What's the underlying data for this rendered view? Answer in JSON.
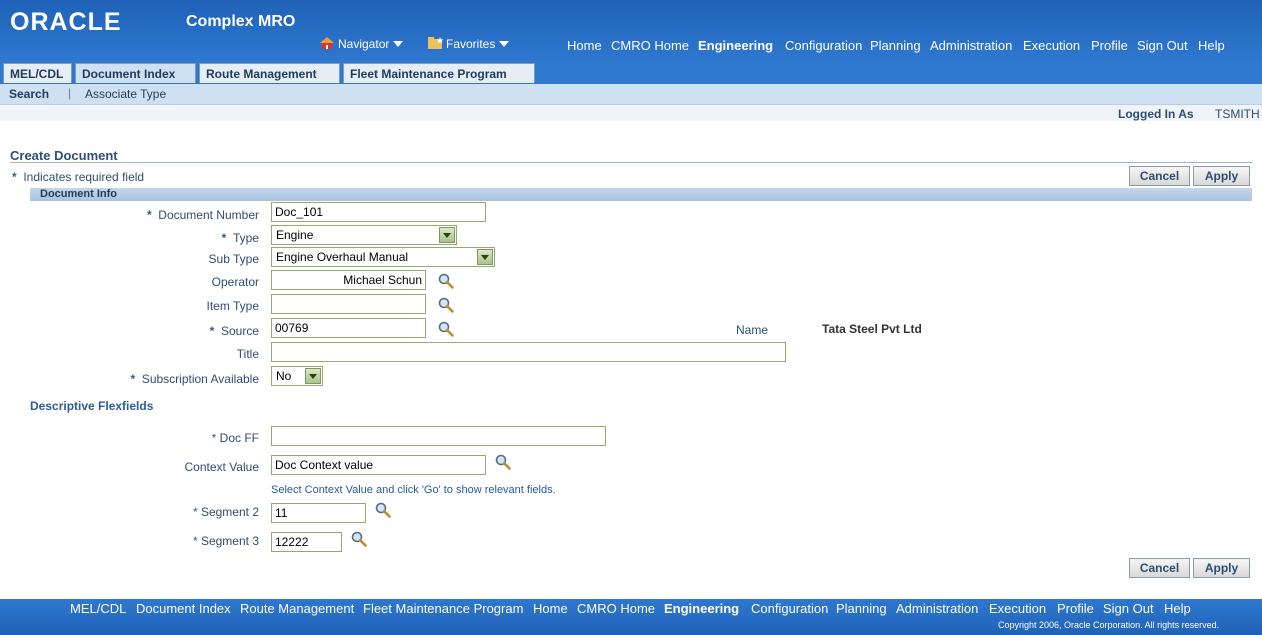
{
  "header": {
    "logo": "ORACLE",
    "app_name": "Complex MRO",
    "navigator": "Navigator",
    "favorites": "Favorites",
    "links": [
      "Home",
      "CMRO Home",
      "Engineering",
      "Configuration",
      "Planning",
      "Administration",
      "Execution",
      "Profile",
      "Sign Out",
      "Help"
    ],
    "active_link": "Engineering"
  },
  "tabs": [
    "MEL/CDL",
    "Document Index",
    "Route Management",
    "Fleet Maintenance Program"
  ],
  "active_tab": "Document Index",
  "subtabs": [
    "Search",
    "Associate Type"
  ],
  "logged_in": {
    "label": "Logged In As",
    "user": "TSMITH"
  },
  "page": {
    "title": "Create Document",
    "required_star": "*",
    "required_note": "Indicates required field",
    "cancel_label": "Cancel",
    "apply_label": "Apply"
  },
  "document_info": {
    "section_title": "Document Info",
    "document_number": {
      "label": "Document Number",
      "value": "Doc_101",
      "required": true
    },
    "type": {
      "label": "Type",
      "value": "Engine",
      "required": true
    },
    "sub_type": {
      "label": "Sub Type",
      "value": "Engine Overhaul Manual"
    },
    "operator": {
      "label": "Operator",
      "value": "Michael Schun"
    },
    "item_type": {
      "label": "Item Type",
      "value": ""
    },
    "source": {
      "label": "Source",
      "value": "00769",
      "required": true
    },
    "name": {
      "label": "Name",
      "value": "Tata Steel Pvt Ltd"
    },
    "title": {
      "label": "Title",
      "value": ""
    },
    "subscription_available": {
      "label": "Subscription Available",
      "value": "No",
      "required": true
    }
  },
  "flexfields": {
    "section_title": "Descriptive Flexfields",
    "doc_ff": {
      "label": "Doc FF",
      "value": ""
    },
    "context_value": {
      "label": "Context Value",
      "value": "Doc Context value"
    },
    "hint": "Select Context Value and click 'Go' to show relevant fields.",
    "segment2": {
      "label": "Segment 2",
      "value": "11"
    },
    "segment3": {
      "label": "Segment 3",
      "value": "12222"
    }
  },
  "footer": {
    "links": [
      "MEL/CDL",
      "Document Index",
      "Route Management",
      "Fleet Maintenance Program",
      "Home",
      "CMRO Home",
      "Engineering",
      "Configuration",
      "Planning",
      "Administration",
      "Execution",
      "Profile",
      "Sign Out",
      "Help"
    ],
    "copyright": "Copyright 2006, Oracle Corporation. All rights reserved."
  },
  "colors": {
    "brand_blue": "#2f78cf",
    "label_text": "#304d6e",
    "field_border": "#95a870"
  }
}
